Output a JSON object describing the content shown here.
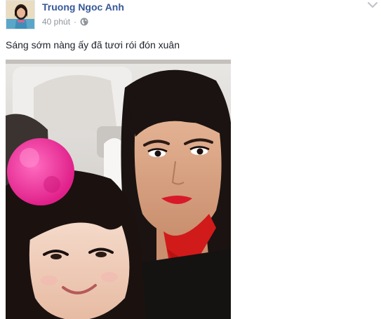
{
  "post": {
    "author_name": "Truong Ngoc Anh",
    "timestamp": "40 phút",
    "separator": "·",
    "privacy_icon": "globe-icon",
    "menu_icon": "chevron-down-icon",
    "caption": "Sáng sớm nàng ấy đã tươi rói đón xuân"
  },
  "colors": {
    "author_link": "#365899",
    "meta_text": "#90949c",
    "body_text": "#1d2129"
  }
}
